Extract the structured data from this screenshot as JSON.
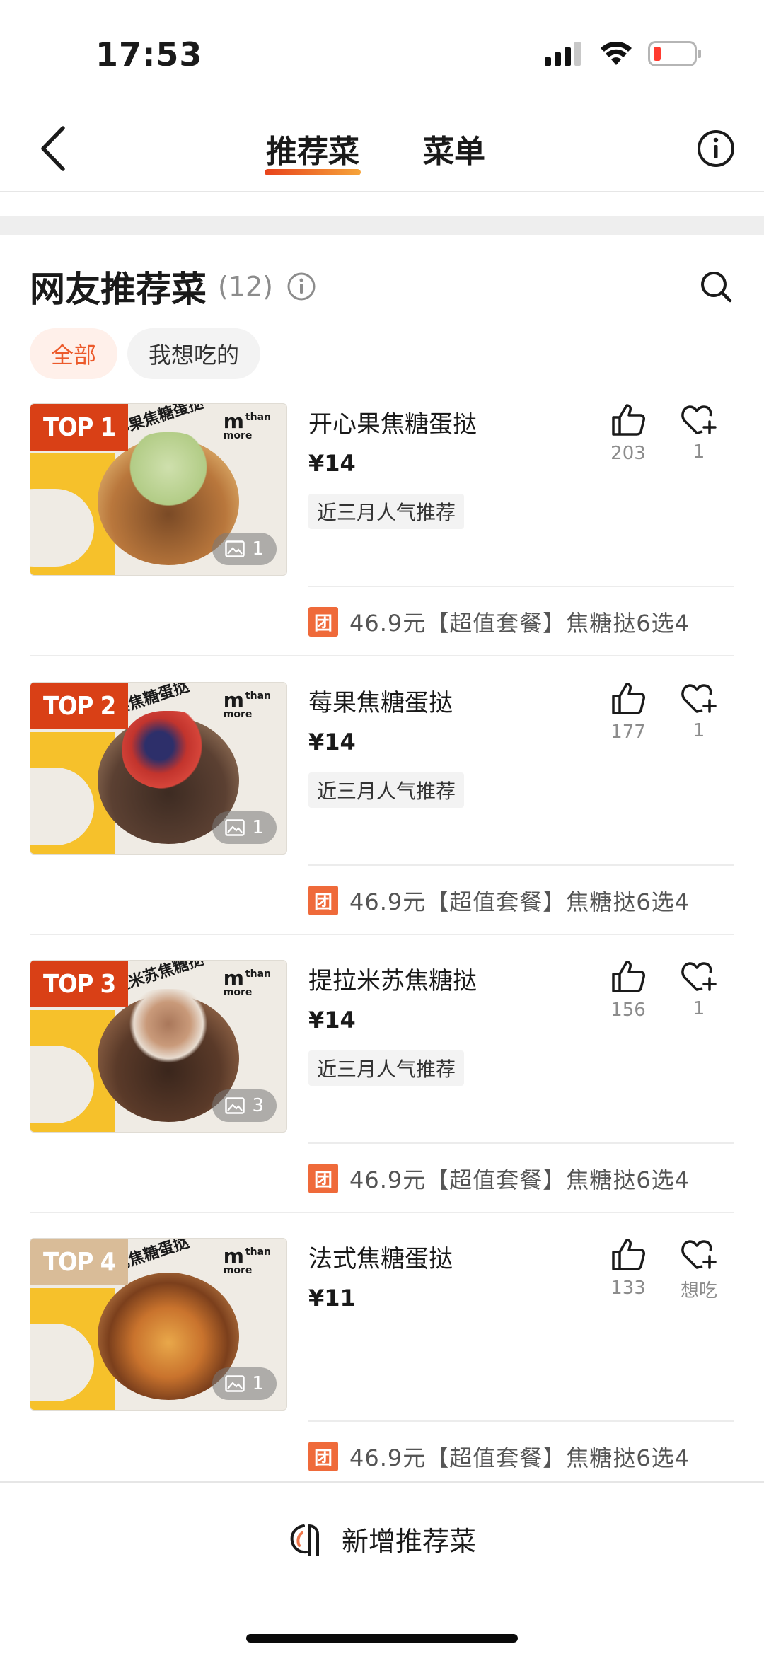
{
  "status_bar": {
    "time": "17:53",
    "icons": [
      "signal-icon",
      "wifi-icon",
      "battery-low-icon"
    ]
  },
  "nav": {
    "tabs": [
      {
        "label": "推荐菜",
        "active": true
      },
      {
        "label": "菜单",
        "active": false
      }
    ],
    "back_icon": "chevron-left-icon",
    "info_icon": "info-icon"
  },
  "section": {
    "title": "网友推荐菜",
    "count": "(12)"
  },
  "filters": [
    {
      "label": "全部",
      "active": true
    },
    {
      "label": "我想吃的",
      "active": false
    }
  ],
  "dishes": [
    {
      "rank": "TOP 1",
      "image_label": "开心果焦糖蛋挞",
      "name": "开心果焦糖蛋挞",
      "price": "¥14",
      "tag": "近三月人气推荐",
      "photos": "1",
      "likes": "203",
      "wants": "1",
      "deal_badge": "团",
      "deal": "46.9元【超值套餐】焦糖挞6选4"
    },
    {
      "rank": "TOP 2",
      "image_label": "莓果焦糖蛋挞",
      "name": "莓果焦糖蛋挞",
      "price": "¥14",
      "tag": "近三月人气推荐",
      "photos": "1",
      "likes": "177",
      "wants": "1",
      "deal_badge": "团",
      "deal": "46.9元【超值套餐】焦糖挞6选4"
    },
    {
      "rank": "TOP 3",
      "image_label": "提拉米苏焦糖挞",
      "name": "提拉米苏焦糖挞",
      "price": "¥14",
      "tag": "近三月人气推荐",
      "photos": "3",
      "likes": "156",
      "wants": "1",
      "deal_badge": "团",
      "deal": "46.9元【超值套餐】焦糖挞6选4"
    },
    {
      "rank": "TOP 4",
      "image_label": "法式焦糖蛋挞",
      "name": "法式焦糖蛋挞",
      "price": "¥11",
      "tag": "",
      "photos": "1",
      "likes": "133",
      "wants": "想吃",
      "deal_badge": "团",
      "deal": "46.9元【超值套餐】焦糖挞6选4"
    }
  ],
  "image_logo": {
    "mark": "m",
    "line1": "than",
    "line2": "more"
  },
  "bottom": {
    "add_label": "新增推荐菜"
  },
  "colors": {
    "accent": "#ec5a2b",
    "top_badge": "#d94016",
    "top_badge_alt": "#d9bc98",
    "deal_badge": "#ef6a3a",
    "brand_yellow": "#f6c12b"
  }
}
